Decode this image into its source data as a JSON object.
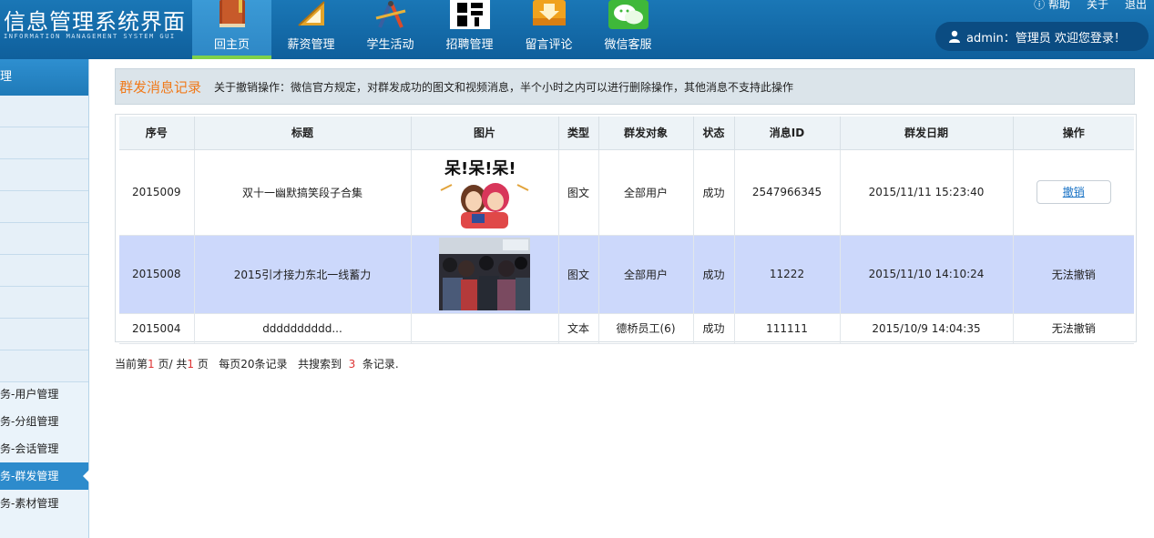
{
  "app": {
    "title": "信息管理系统界面",
    "subtitle": "INFORMATION MANAGEMENT SYSTEM GUI"
  },
  "nav": {
    "items": [
      {
        "label": "回主页",
        "icon": "book-icon",
        "active": true
      },
      {
        "label": "薪资管理",
        "icon": "ruler-triangle-icon"
      },
      {
        "label": "学生活动",
        "icon": "drafting-compass-icon"
      },
      {
        "label": "招聘管理",
        "icon": "recruit-glyph-icon"
      },
      {
        "label": "留言评论",
        "icon": "download-box-icon"
      },
      {
        "label": "微信客服",
        "icon": "wechat-icon"
      }
    ]
  },
  "toplinks": {
    "help": "帮助",
    "about": "关于",
    "logout": "退出"
  },
  "user": {
    "text": "admin：管理员  欢迎您登录！"
  },
  "sidebar": {
    "header": "理",
    "items": [
      {
        "label": "务-用户管理"
      },
      {
        "label": "务-分组管理"
      },
      {
        "label": "务-会话管理"
      },
      {
        "label": "务-群发管理",
        "active": true
      },
      {
        "label": "务-素材管理"
      }
    ]
  },
  "panel": {
    "title": "群发消息记录",
    "note": "关于撤销操作：微信官方规定，对群发成功的图文和视频消息，半个小时之内可以进行删除操作，其他消息不支持此操作"
  },
  "table": {
    "headers": [
      "序号",
      "标题",
      "图片",
      "类型",
      "群发对象",
      "状态",
      "消息ID",
      "群发日期",
      "操作"
    ],
    "rows": [
      {
        "id": "2015009",
        "title": "双十一幽默搞笑段子合集",
        "image": "cartoon-couple-image",
        "type": "图文",
        "target": "全部用户",
        "status": "成功",
        "msgid": "2547966345",
        "date": "2015/11/11 15:23:40",
        "action": "撤销",
        "action_is_button": true
      },
      {
        "id": "2015008",
        "title": "2015引才接力东北一线蓄力",
        "image": "crowd-photo-image",
        "type": "图文",
        "target": "全部用户",
        "status": "成功",
        "msgid": "11222",
        "date": "2015/11/10 14:10:24",
        "action": "无法撤销"
      },
      {
        "id": "2015004",
        "title": "dddddddddd...",
        "image": "",
        "type": "文本",
        "target": "德桥员工(6)",
        "status": "成功",
        "msgid": "111111",
        "date": "2015/10/9 14:04:35",
        "action": "无法撤销"
      }
    ]
  },
  "pager": {
    "prefix": "当前第",
    "current": "1",
    "mid1": " 页/ 共",
    "total": "1",
    "mid2": " 页   每页20条记录   共搜索到  ",
    "count": "3",
    "suffix": "  条记录."
  },
  "colors": {
    "header_bg": "#1a77b6",
    "active_tab_accent": "#7fd14a",
    "highlight_row": "#ccd8fb",
    "title_orange": "#f07a1b"
  }
}
